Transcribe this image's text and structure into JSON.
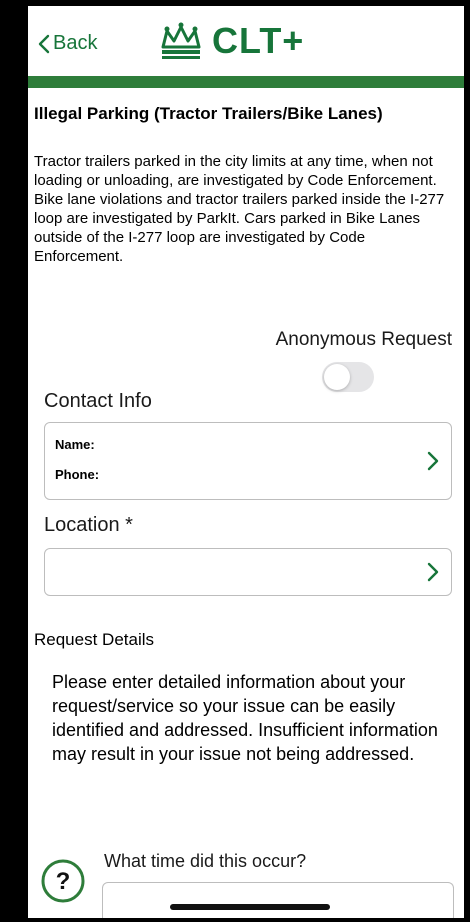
{
  "header": {
    "back_label": "Back",
    "brand": "CLT+"
  },
  "colors": {
    "brand_green": "#17753a",
    "bar_green": "#2e7d3a",
    "toggle_off": "#e5e5e7"
  },
  "icons": {
    "back": "chevron-left-icon",
    "logo": "crown-icon",
    "card_arrow": "chevron-right-icon",
    "help": "question-circle-icon"
  },
  "page": {
    "title": "Illegal Parking (Tractor Trailers/Bike Lanes)",
    "description": "Tractor trailers parked in the city limits at any time, when not loading or unloading, are investigated by Code Enforcement. Bike lane violations and tractor trailers parked inside the I-277 loop are investigated by ParkIt. Cars parked in Bike Lanes outside of the I-277 loop are investigated by Code Enforcement."
  },
  "anonymous": {
    "label": "Anonymous Request",
    "enabled": false
  },
  "contact": {
    "section_label": "Contact Info",
    "name_label": "Name:",
    "phone_label": "Phone:"
  },
  "location": {
    "section_label": "Location *",
    "value": ""
  },
  "request_details": {
    "label": "Request Details",
    "instructions": "Please enter detailed information about your request/service so your issue can be easily identified and addressed. Insufficient information may result in your issue not being addressed."
  },
  "question": {
    "label": "What time did this occur?",
    "value": ""
  }
}
